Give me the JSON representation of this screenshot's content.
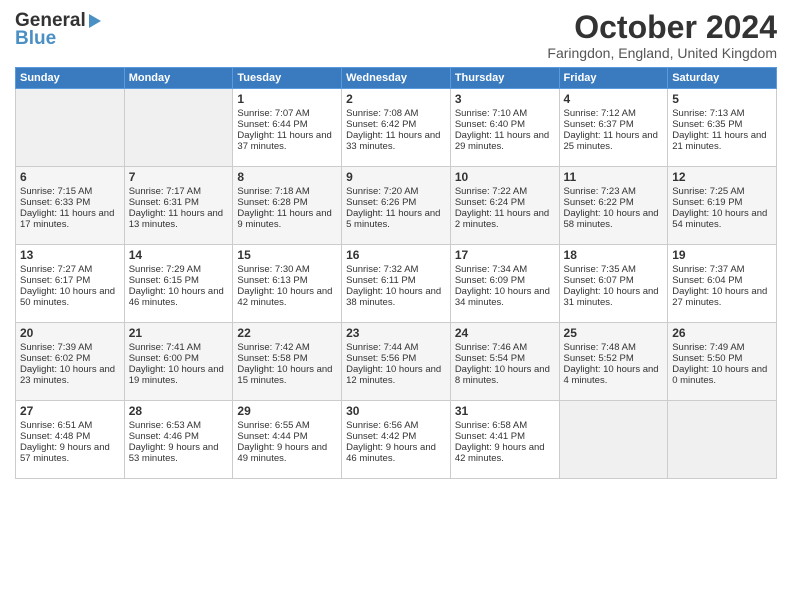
{
  "logo": {
    "line1": "General",
    "line2": "Blue"
  },
  "title": "October 2024",
  "subtitle": "Faringdon, England, United Kingdom",
  "days_of_week": [
    "Sunday",
    "Monday",
    "Tuesday",
    "Wednesday",
    "Thursday",
    "Friday",
    "Saturday"
  ],
  "weeks": [
    [
      {
        "day": "",
        "info": ""
      },
      {
        "day": "",
        "info": ""
      },
      {
        "day": "1",
        "sunrise": "Sunrise: 7:07 AM",
        "sunset": "Sunset: 6:44 PM",
        "daylight": "Daylight: 11 hours and 37 minutes."
      },
      {
        "day": "2",
        "sunrise": "Sunrise: 7:08 AM",
        "sunset": "Sunset: 6:42 PM",
        "daylight": "Daylight: 11 hours and 33 minutes."
      },
      {
        "day": "3",
        "sunrise": "Sunrise: 7:10 AM",
        "sunset": "Sunset: 6:40 PM",
        "daylight": "Daylight: 11 hours and 29 minutes."
      },
      {
        "day": "4",
        "sunrise": "Sunrise: 7:12 AM",
        "sunset": "Sunset: 6:37 PM",
        "daylight": "Daylight: 11 hours and 25 minutes."
      },
      {
        "day": "5",
        "sunrise": "Sunrise: 7:13 AM",
        "sunset": "Sunset: 6:35 PM",
        "daylight": "Daylight: 11 hours and 21 minutes."
      }
    ],
    [
      {
        "day": "6",
        "sunrise": "Sunrise: 7:15 AM",
        "sunset": "Sunset: 6:33 PM",
        "daylight": "Daylight: 11 hours and 17 minutes."
      },
      {
        "day": "7",
        "sunrise": "Sunrise: 7:17 AM",
        "sunset": "Sunset: 6:31 PM",
        "daylight": "Daylight: 11 hours and 13 minutes."
      },
      {
        "day": "8",
        "sunrise": "Sunrise: 7:18 AM",
        "sunset": "Sunset: 6:28 PM",
        "daylight": "Daylight: 11 hours and 9 minutes."
      },
      {
        "day": "9",
        "sunrise": "Sunrise: 7:20 AM",
        "sunset": "Sunset: 6:26 PM",
        "daylight": "Daylight: 11 hours and 5 minutes."
      },
      {
        "day": "10",
        "sunrise": "Sunrise: 7:22 AM",
        "sunset": "Sunset: 6:24 PM",
        "daylight": "Daylight: 11 hours and 2 minutes."
      },
      {
        "day": "11",
        "sunrise": "Sunrise: 7:23 AM",
        "sunset": "Sunset: 6:22 PM",
        "daylight": "Daylight: 10 hours and 58 minutes."
      },
      {
        "day": "12",
        "sunrise": "Sunrise: 7:25 AM",
        "sunset": "Sunset: 6:19 PM",
        "daylight": "Daylight: 10 hours and 54 minutes."
      }
    ],
    [
      {
        "day": "13",
        "sunrise": "Sunrise: 7:27 AM",
        "sunset": "Sunset: 6:17 PM",
        "daylight": "Daylight: 10 hours and 50 minutes."
      },
      {
        "day": "14",
        "sunrise": "Sunrise: 7:29 AM",
        "sunset": "Sunset: 6:15 PM",
        "daylight": "Daylight: 10 hours and 46 minutes."
      },
      {
        "day": "15",
        "sunrise": "Sunrise: 7:30 AM",
        "sunset": "Sunset: 6:13 PM",
        "daylight": "Daylight: 10 hours and 42 minutes."
      },
      {
        "day": "16",
        "sunrise": "Sunrise: 7:32 AM",
        "sunset": "Sunset: 6:11 PM",
        "daylight": "Daylight: 10 hours and 38 minutes."
      },
      {
        "day": "17",
        "sunrise": "Sunrise: 7:34 AM",
        "sunset": "Sunset: 6:09 PM",
        "daylight": "Daylight: 10 hours and 34 minutes."
      },
      {
        "day": "18",
        "sunrise": "Sunrise: 7:35 AM",
        "sunset": "Sunset: 6:07 PM",
        "daylight": "Daylight: 10 hours and 31 minutes."
      },
      {
        "day": "19",
        "sunrise": "Sunrise: 7:37 AM",
        "sunset": "Sunset: 6:04 PM",
        "daylight": "Daylight: 10 hours and 27 minutes."
      }
    ],
    [
      {
        "day": "20",
        "sunrise": "Sunrise: 7:39 AM",
        "sunset": "Sunset: 6:02 PM",
        "daylight": "Daylight: 10 hours and 23 minutes."
      },
      {
        "day": "21",
        "sunrise": "Sunrise: 7:41 AM",
        "sunset": "Sunset: 6:00 PM",
        "daylight": "Daylight: 10 hours and 19 minutes."
      },
      {
        "day": "22",
        "sunrise": "Sunrise: 7:42 AM",
        "sunset": "Sunset: 5:58 PM",
        "daylight": "Daylight: 10 hours and 15 minutes."
      },
      {
        "day": "23",
        "sunrise": "Sunrise: 7:44 AM",
        "sunset": "Sunset: 5:56 PM",
        "daylight": "Daylight: 10 hours and 12 minutes."
      },
      {
        "day": "24",
        "sunrise": "Sunrise: 7:46 AM",
        "sunset": "Sunset: 5:54 PM",
        "daylight": "Daylight: 10 hours and 8 minutes."
      },
      {
        "day": "25",
        "sunrise": "Sunrise: 7:48 AM",
        "sunset": "Sunset: 5:52 PM",
        "daylight": "Daylight: 10 hours and 4 minutes."
      },
      {
        "day": "26",
        "sunrise": "Sunrise: 7:49 AM",
        "sunset": "Sunset: 5:50 PM",
        "daylight": "Daylight: 10 hours and 0 minutes."
      }
    ],
    [
      {
        "day": "27",
        "sunrise": "Sunrise: 6:51 AM",
        "sunset": "Sunset: 4:48 PM",
        "daylight": "Daylight: 9 hours and 57 minutes."
      },
      {
        "day": "28",
        "sunrise": "Sunrise: 6:53 AM",
        "sunset": "Sunset: 4:46 PM",
        "daylight": "Daylight: 9 hours and 53 minutes."
      },
      {
        "day": "29",
        "sunrise": "Sunrise: 6:55 AM",
        "sunset": "Sunset: 4:44 PM",
        "daylight": "Daylight: 9 hours and 49 minutes."
      },
      {
        "day": "30",
        "sunrise": "Sunrise: 6:56 AM",
        "sunset": "Sunset: 4:42 PM",
        "daylight": "Daylight: 9 hours and 46 minutes."
      },
      {
        "day": "31",
        "sunrise": "Sunrise: 6:58 AM",
        "sunset": "Sunset: 4:41 PM",
        "daylight": "Daylight: 9 hours and 42 minutes."
      },
      {
        "day": "",
        "info": ""
      },
      {
        "day": "",
        "info": ""
      }
    ]
  ]
}
